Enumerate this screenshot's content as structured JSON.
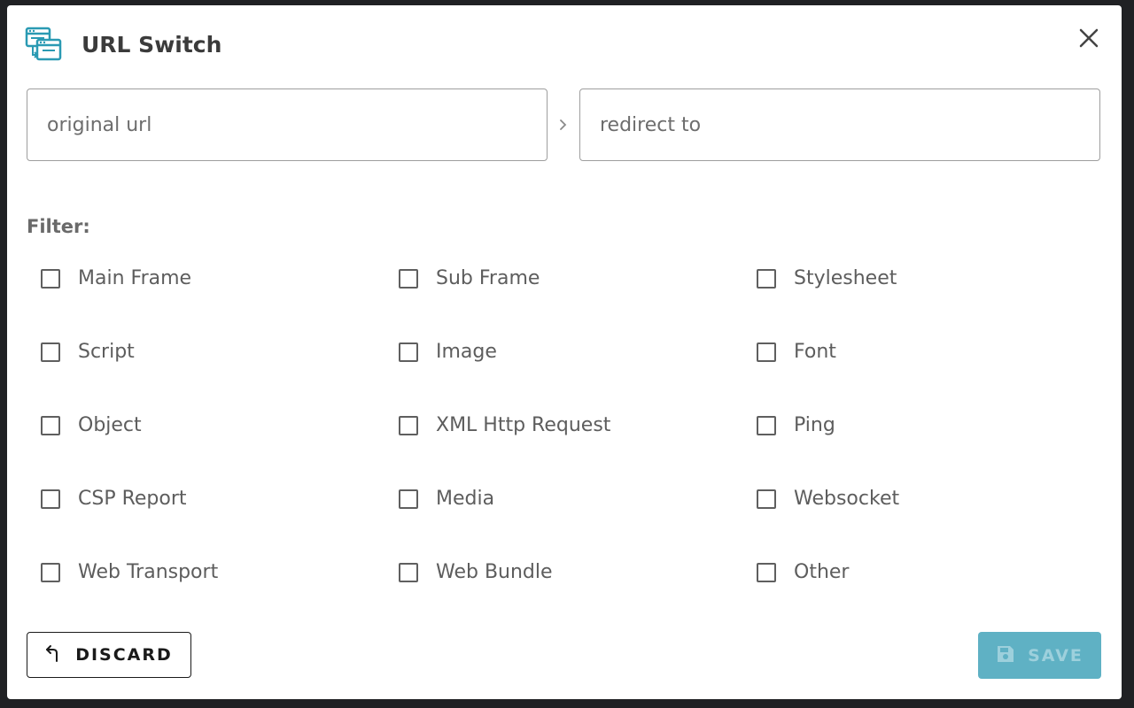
{
  "header": {
    "title": "URL Switch",
    "icon": "url-switch-app-icon",
    "close_icon": "close-icon"
  },
  "url_row": {
    "original_placeholder": "original url",
    "original_value": "",
    "redirect_placeholder": "redirect to",
    "redirect_value": "",
    "separator_icon": "chevron-right-icon"
  },
  "filter": {
    "label": "Filter:",
    "items": [
      {
        "label": "Main Frame",
        "checked": false
      },
      {
        "label": "Sub Frame",
        "checked": false
      },
      {
        "label": "Stylesheet",
        "checked": false
      },
      {
        "label": "Script",
        "checked": false
      },
      {
        "label": "Image",
        "checked": false
      },
      {
        "label": "Font",
        "checked": false
      },
      {
        "label": "Object",
        "checked": false
      },
      {
        "label": "XML Http Request",
        "checked": false
      },
      {
        "label": "Ping",
        "checked": false
      },
      {
        "label": "CSP Report",
        "checked": false
      },
      {
        "label": "Media",
        "checked": false
      },
      {
        "label": "Websocket",
        "checked": false
      },
      {
        "label": "Web Transport",
        "checked": false
      },
      {
        "label": "Web Bundle",
        "checked": false
      },
      {
        "label": "Other",
        "checked": false
      }
    ]
  },
  "actions": {
    "discard_label": "DISCARD",
    "discard_icon": "undo-icon",
    "save_label": "SAVE",
    "save_icon": "floppy-disk-icon"
  },
  "colors": {
    "accent": "#2a9ab3",
    "save_button_bg": "#5fb1c4",
    "save_button_text": "#9dd0dc"
  }
}
